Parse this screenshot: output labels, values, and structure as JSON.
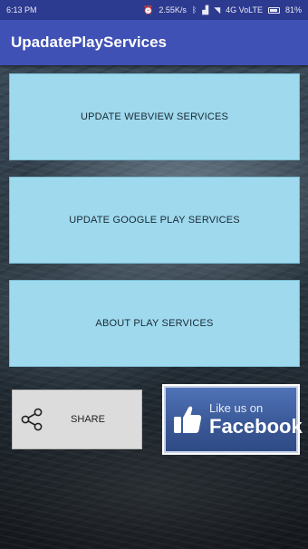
{
  "status_bar": {
    "time": "6:13 PM",
    "speed": "2.55K/s",
    "network": "4G VoLTE",
    "battery": "81%"
  },
  "app_bar": {
    "title": "UpadatePlayServices"
  },
  "buttons": {
    "update_webview": "UPDATE WEBVIEW SERVICES",
    "update_google_play": "UPDATE GOOGLE PLAY SERVICES",
    "about_play": "ABOUT PLAY SERVICES",
    "share": "SHARE"
  },
  "facebook": {
    "like_text": "Like us on",
    "brand_text": "Facebook"
  },
  "colors": {
    "status_bar": "#2c3a8f",
    "app_bar": "#3f51b5",
    "button_bg": "#9ed9ee",
    "share_bg": "#dcdcdc",
    "facebook_blue": "#3b5998"
  },
  "icons": [
    "alarm-icon",
    "bluetooth-icon",
    "signal-icon",
    "wifi-icon",
    "battery-icon",
    "share-icon",
    "thumbs-up-icon"
  ]
}
